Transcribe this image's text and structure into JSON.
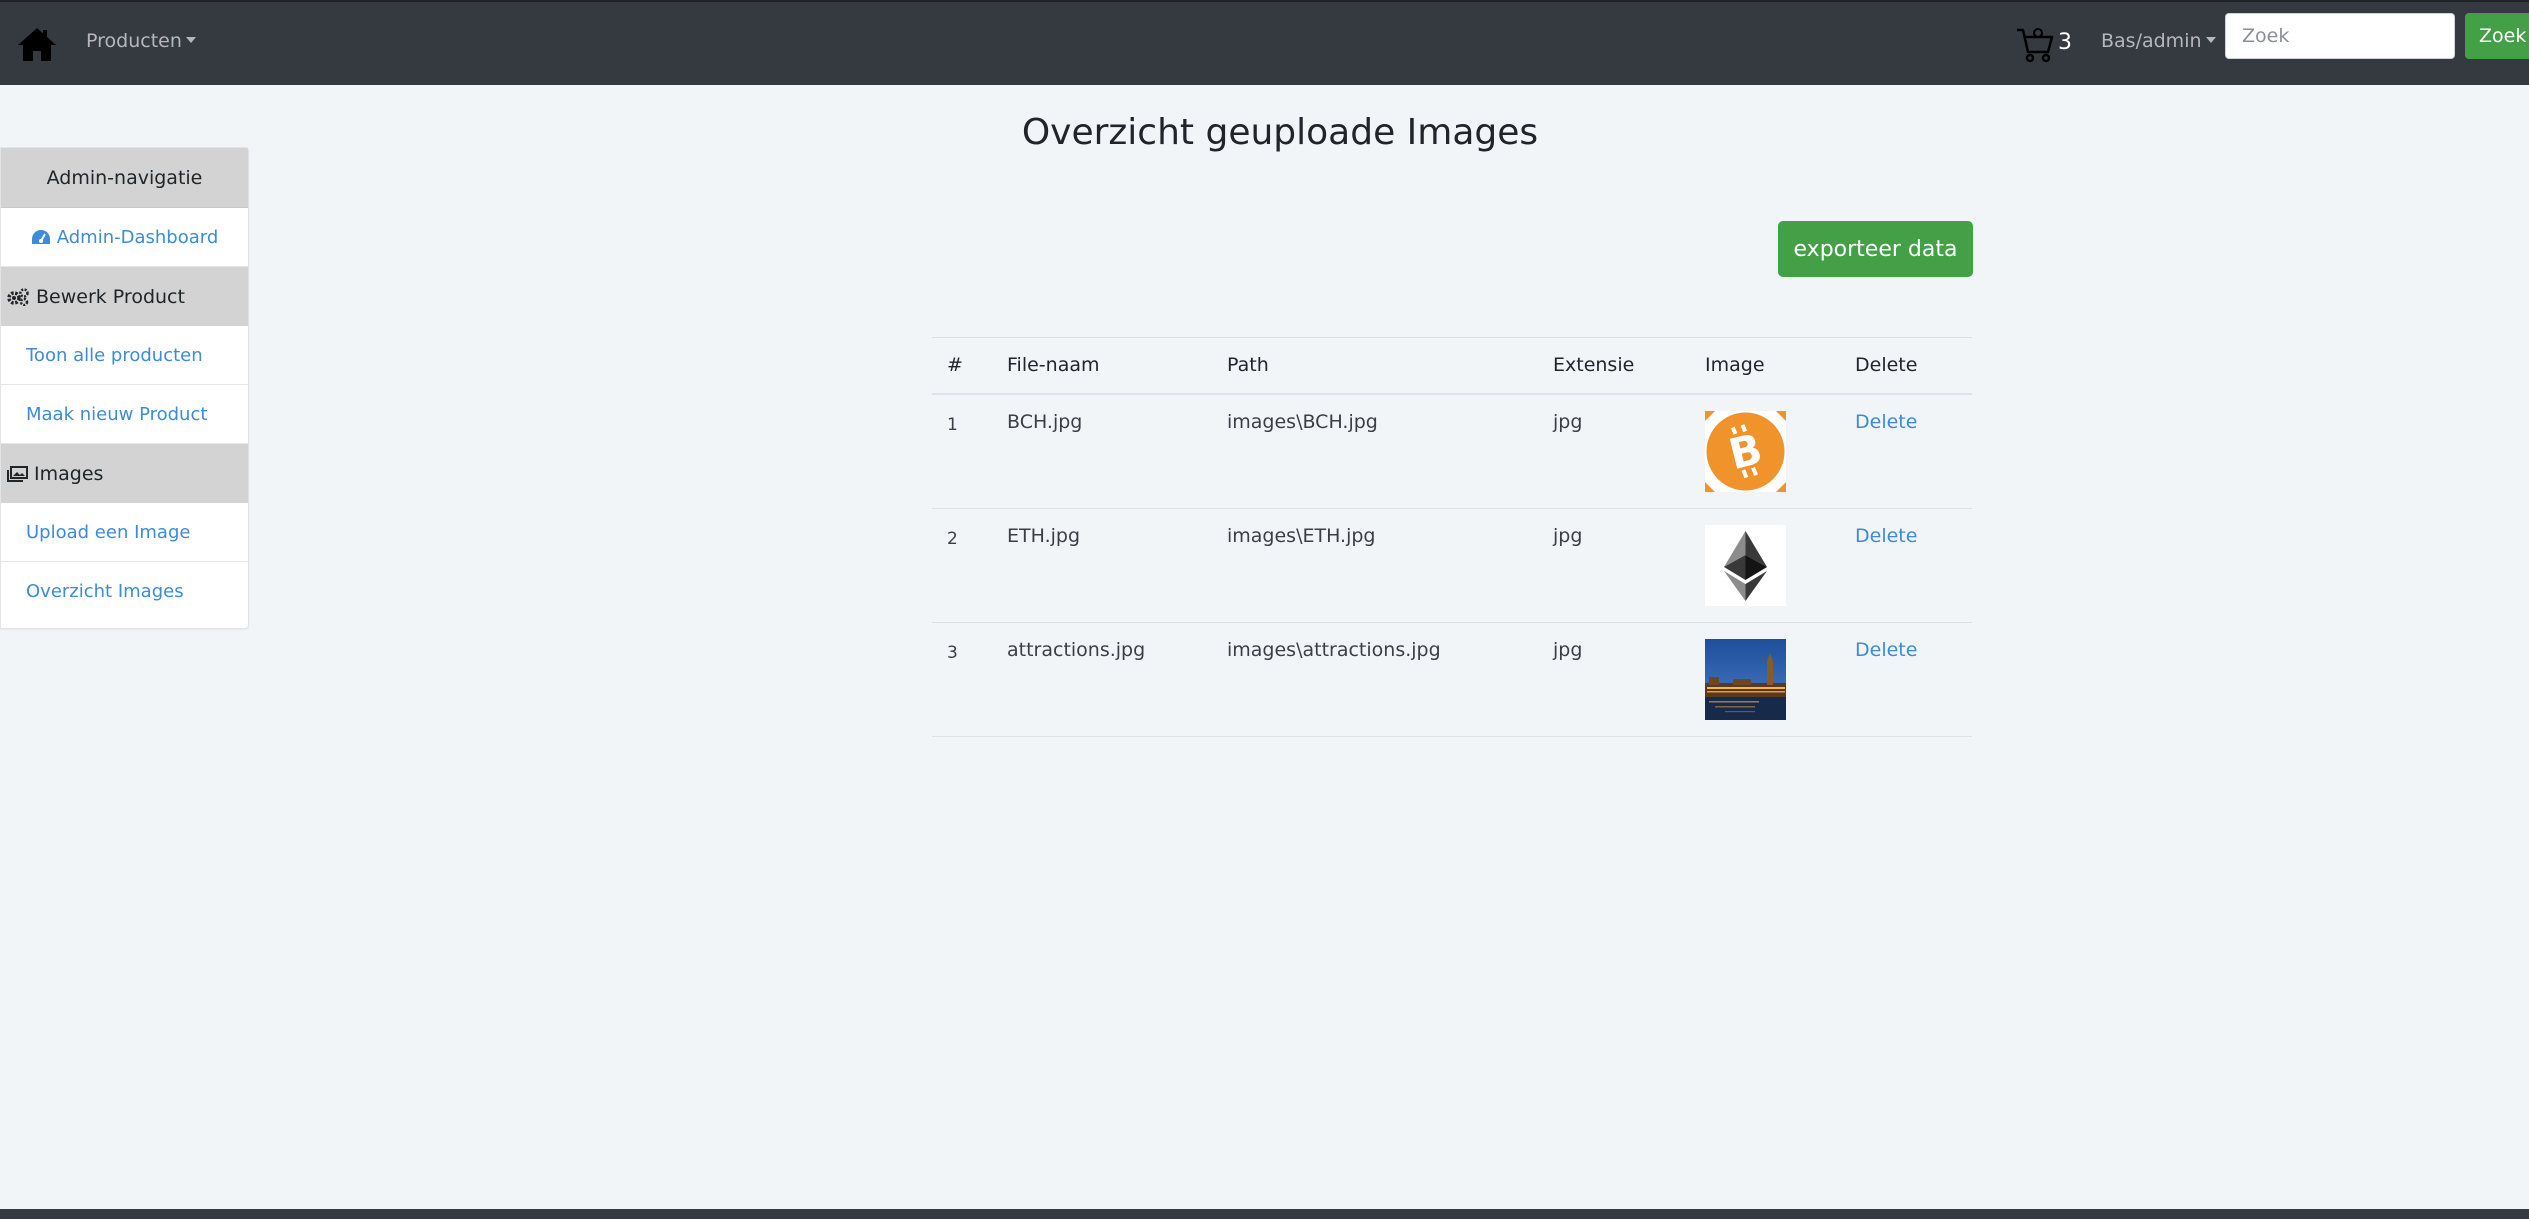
{
  "navbar": {
    "products_label": "Producten",
    "cart_count": "3",
    "user_label": "Bas/admin",
    "search_placeholder": "Zoek",
    "search_button": "Zoek"
  },
  "sidebar": {
    "header": "Admin-navigatie",
    "dashboard_link": "Admin-Dashboard",
    "section_product": "Bewerk Product",
    "product_links": [
      "Toon alle producten",
      "Maak nieuw Product"
    ],
    "section_images": "Images",
    "image_links": [
      "Upload een Image",
      "Overzicht Images"
    ]
  },
  "main": {
    "title": "Overzicht geuploade Images",
    "export_button": "exporteer data",
    "columns": [
      "#",
      "File-naam",
      "Path",
      "Extensie",
      "Image",
      "Delete"
    ],
    "rows": [
      {
        "num": "1",
        "file": "BCH.jpg",
        "path": "images\\BCH.jpg",
        "ext": "jpg",
        "image": "bitcoin-cash-logo",
        "action": "Delete"
      },
      {
        "num": "2",
        "file": "ETH.jpg",
        "path": "images\\ETH.jpg",
        "ext": "jpg",
        "image": "ethereum-logo",
        "action": "Delete"
      },
      {
        "num": "3",
        "file": "attractions.jpg",
        "path": "images\\attractions.jpg",
        "ext": "jpg",
        "image": "london-night-photo",
        "action": "Delete"
      }
    ]
  },
  "colors": {
    "navbar_bg": "#343a40",
    "button_green": "#43a047",
    "link_blue": "#3d8bd9",
    "sidebar_header_bg": "#d3d3d3",
    "page_bg": "#f2f5f8"
  }
}
